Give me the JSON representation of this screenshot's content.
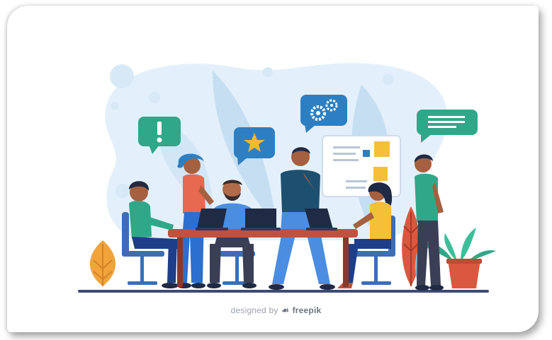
{
  "illustration": {
    "credit_prefix": "designed by",
    "credit_brand": "freepik",
    "logo_icon": "freepik-logo-icon",
    "icons": [
      "exclamation-icon",
      "star-icon",
      "gears-icon",
      "message-lines-icon",
      "laptop-icon"
    ],
    "colors": {
      "background_blob": "#e3f0fb",
      "leaf": "#b9d7ef",
      "bubble_green": "#2fa889",
      "bubble_blue": "#2d7fc1",
      "star": "#f4b92f",
      "table": "#c0513f",
      "floor": "#3c4a74",
      "plant_orange": "#f0a43a",
      "pot": "#d9583f"
    }
  }
}
